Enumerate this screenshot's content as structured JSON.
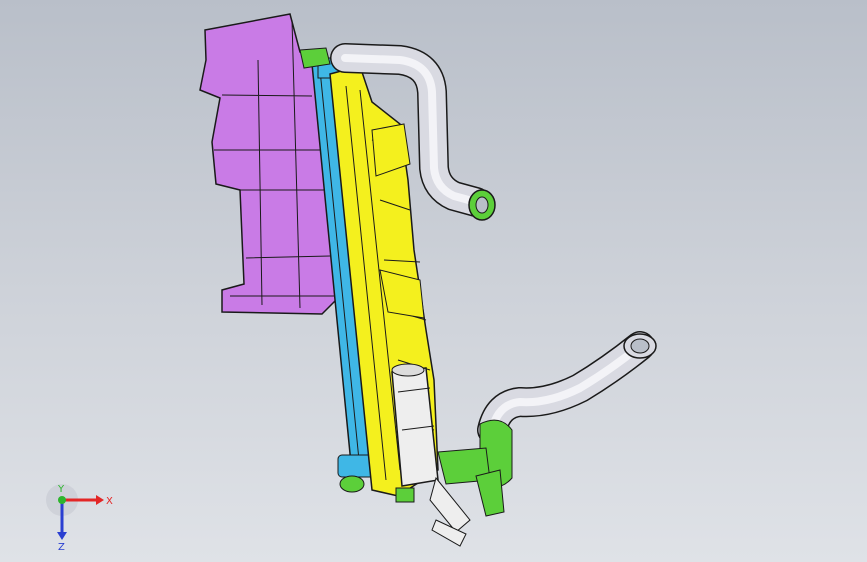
{
  "viewport": {
    "background_top": "#b9bfc9",
    "background_bottom": "#dfe2e7"
  },
  "model": {
    "parts": [
      {
        "name": "shroud-part",
        "color": "#c97be6"
      },
      {
        "name": "radiator-core-part",
        "color": "#3fb7e6"
      },
      {
        "name": "frame-part",
        "color": "#f4f01e"
      },
      {
        "name": "upper-hose-part",
        "color": "#d9dae2"
      },
      {
        "name": "lower-hose-part",
        "color": "#d9dae2"
      },
      {
        "name": "hose-clamp-part",
        "color": "#5ccf3a"
      },
      {
        "name": "reservoir-part",
        "color": "#eeeeee"
      }
    ],
    "edge_color": "#1a1a1a"
  },
  "triad": {
    "x_label": "X",
    "y_label": "Y",
    "z_label": "Z",
    "x_color": "#e32626",
    "y_color": "#2db52d",
    "z_color": "#2a3fd1"
  }
}
